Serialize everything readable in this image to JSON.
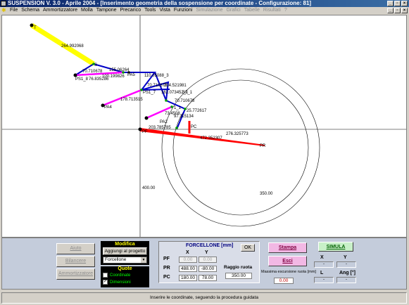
{
  "window": {
    "title": "SUSPENSION V. 3.0 - Aprile 2004 - [Inserimento geometria della sospensione per coordinate - Configurazione: 81]",
    "min": "_",
    "max": "▫",
    "close": "×"
  },
  "menu": {
    "items": [
      "File",
      "Schema",
      "Ammortizzatore",
      "Molla",
      "Tampone",
      "Precarico",
      "Tools",
      "Vista",
      "Funzioni"
    ],
    "disabled": [
      "Simulazione",
      "Grafici",
      "Tabelle",
      "Risultati",
      "?"
    ]
  },
  "canvas": {
    "labels": {
      "t": "T",
      "yellow_len": "264.992068",
      "s": "S",
      "n70a": "70.710678",
      "n155": "155.06264",
      "ps1": "PS1_8",
      "n76": "76.835286",
      "n100": "100.199826",
      "pa5": "PA5",
      "n110": "110.05088_3",
      "n70b": "70.710678",
      "n214": "214.521981",
      "ps1b": "PS1_7",
      "n162": "162.073452_1",
      "s2": "S2_1",
      "n178": "178.713515",
      "pa4": "PA4",
      "n70c": "70.710678",
      "n25": "25.772617",
      "n1": "1_1",
      "n73": "73.4508",
      "n97": "97.115134",
      "pa2": "PA2",
      "n203": "203.785785",
      "pc": "PC",
      "pf": "PF",
      "n276": "276.325773",
      "n472": "472.352307",
      "pr": "PR",
      "r400": "400.00",
      "r350": "350.00"
    }
  },
  "panel": {
    "aiuto": "Aiuto",
    "bilancere": "Bilancere",
    "ammortizzatore": "Ammortizzatore",
    "modifica_title": "Modifica",
    "aggiungi": "Aggiungi al progetto",
    "select_value": "Forcellone",
    "quote_title": "Quote",
    "coordinate": "Coordinate",
    "dimensioni": "Dimensioni",
    "forcellone": {
      "title": "FORCELLONE [mm]",
      "ok": "OK",
      "x_header": "X",
      "y_header": "Y",
      "rows": [
        {
          "label": "PF",
          "x": "0.00",
          "y": "0.00"
        },
        {
          "label": "PR",
          "x": "488.00",
          "y": "-80.00"
        },
        {
          "label": "PC",
          "x": "180.00",
          "y": "78.00"
        }
      ],
      "raggio_label": "Raggio ruota",
      "raggio_value": "350.00"
    },
    "stampa": "Stampa",
    "esci": "Esci",
    "escursione_label": "Massima escursione ruota [mm]",
    "escursione_value": "0.00",
    "simula": "SIMULA",
    "x_label": "X",
    "y_label": "Y",
    "l_label": "L",
    "ang_label": "Ang [°]",
    "dash": "-"
  },
  "status": {
    "text": "Inserire le coordinate, seguendo la procedura guidata"
  },
  "colors": {
    "yellow": "#ffff00",
    "blue": "#0000c8",
    "magenta": "#ff00ff",
    "red": "#ff0000",
    "green": "#00a000"
  }
}
